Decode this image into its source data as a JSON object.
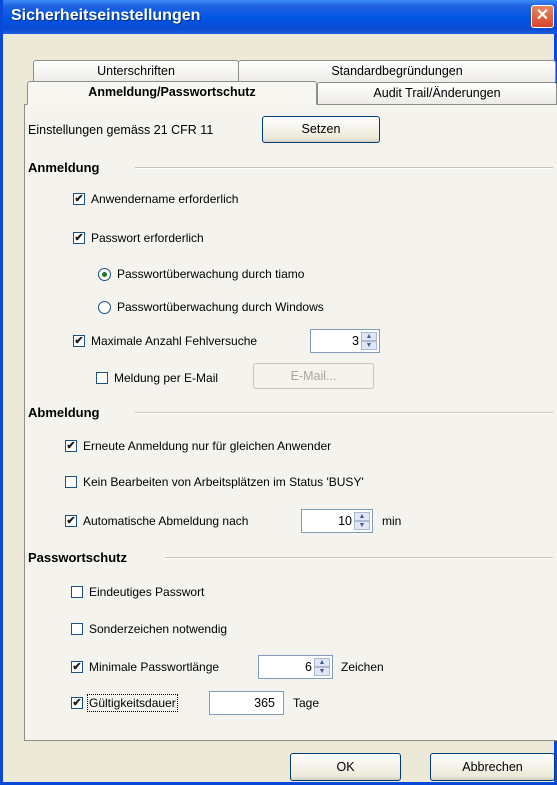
{
  "window": {
    "title": "Sicherheitseinstellungen",
    "close_glyph": "✕"
  },
  "tabs": {
    "row1": [
      "Unterschriften",
      "Standardbegründungen"
    ],
    "row2": [
      "Anmeldung/Passwortschutz",
      "Audit Trail/Änderungen"
    ],
    "active": "Anmeldung/Passwortschutz"
  },
  "cfr": {
    "label": "Einstellungen gemäss 21 CFR 11",
    "button": "Setzen"
  },
  "anmeldung": {
    "title": "Anmeldung",
    "username_required": {
      "label": "Anwendername erforderlich",
      "checked": true
    },
    "password_required": {
      "label": "Passwort erforderlich",
      "checked": true
    },
    "monitor_tiamo": {
      "label": "Passwortüberwachung durch tiamo",
      "selected": true
    },
    "monitor_windows": {
      "label": "Passwortüberwachung durch Windows",
      "selected": false
    },
    "max_attempts": {
      "label": "Maximale Anzahl Fehlversuche",
      "value": "3",
      "checked": true
    },
    "email_notice": {
      "label": "Meldung per E-Mail",
      "button": "E-Mail...",
      "checked": false
    }
  },
  "abmeldung": {
    "title": "Abmeldung",
    "same_user": {
      "label": "Erneute Anmeldung nur für gleichen Anwender",
      "checked": true
    },
    "no_edit_busy": {
      "label": "Kein Bearbeiten von Arbeitsplätzen im Status 'BUSY'",
      "checked": false
    },
    "auto_logout": {
      "label": "Automatische Abmeldung nach",
      "value": "10",
      "unit": "min",
      "checked": true
    }
  },
  "passwortschutz": {
    "title": "Passwortschutz",
    "unique_password": {
      "label": "Eindeutiges Passwort",
      "checked": false
    },
    "special_chars": {
      "label": "Sonderzeichen notwendig",
      "checked": false
    },
    "min_length": {
      "label": "Minimale Passwortlänge",
      "value": "6",
      "unit": "Zeichen",
      "checked": true
    },
    "validity": {
      "label": "Gültigkeitsdauer",
      "value": "365",
      "unit": "Tage",
      "checked": true
    }
  },
  "footer": {
    "ok": "OK",
    "cancel": "Abbrechen"
  },
  "glyphs": {
    "check": "✔",
    "up": "▲",
    "down": "▼"
  },
  "colors": {
    "titlebar": "#0054e3",
    "close": "#d9442a",
    "face": "#ece9d8"
  }
}
